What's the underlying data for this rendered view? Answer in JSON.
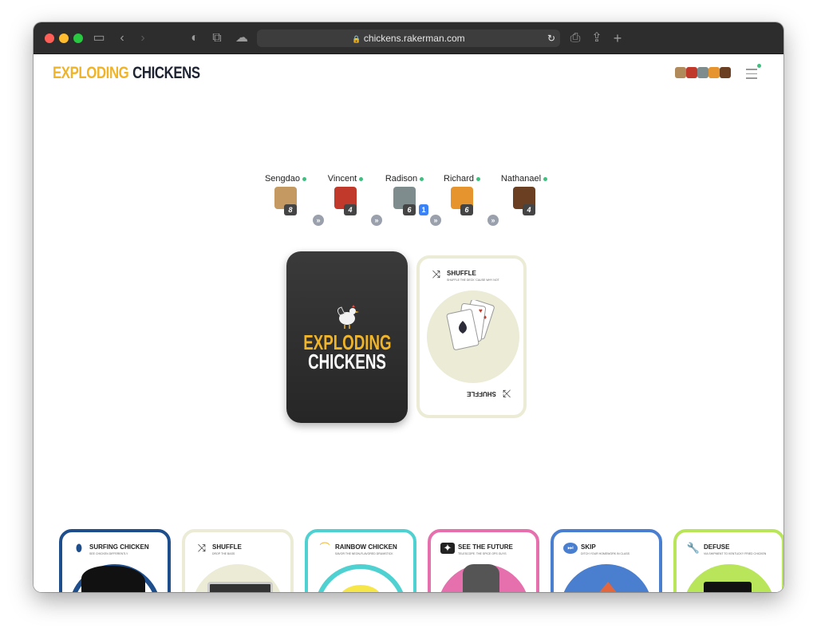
{
  "browser": {
    "url": "chickens.rakerman.com",
    "lock_icon": "lock-icon"
  },
  "header": {
    "logo_part1": "EXPLODING",
    "logo_part2": "CHICKENS",
    "menu_icon": "hamburger-icon"
  },
  "players": [
    {
      "name": "Sengdao",
      "count": "8",
      "animal": "pug"
    },
    {
      "name": "Vincent",
      "count": "4",
      "animal": "bull"
    },
    {
      "name": "Radison",
      "count": "6",
      "badge": "1",
      "animal": "wolf"
    },
    {
      "name": "Richard",
      "count": "6",
      "animal": "lion"
    },
    {
      "name": "Nathanael",
      "count": "4",
      "animal": "bear"
    }
  ],
  "deck": {
    "line1": "EXPLODING",
    "line2": "CHICKENS"
  },
  "discard": {
    "title": "SHUFFLE",
    "subtitle": "SHUFFLE THE DECK 'CAUSE WHY NOT",
    "bottom_label": "SHUFFLE"
  },
  "hand": [
    {
      "title": "SURFING CHICKEN",
      "subtitle": "SEE CHICKEN DIFFERENTLY",
      "color": "#1f4e8c",
      "icon": "surfboard-icon"
    },
    {
      "title": "SHUFFLE",
      "subtitle": "DROP THE BASS",
      "color": "#ecebd6",
      "icon": "shuffle-icon"
    },
    {
      "title": "RAINBOW CHICKEN",
      "subtitle": "SAVOR THE NEON-FLAVORED DRUMSTICK",
      "color": "#4fd1d1",
      "icon": "rainbow-icon"
    },
    {
      "title": "SEE THE FUTURE",
      "subtitle": "TELESCOPE. THE SPICE OPS GUYS",
      "color": "#e66fae",
      "icon": "telescope-icon"
    },
    {
      "title": "SKIP",
      "subtitle": "DITCH YOUR HOMEWORK IN CLASS",
      "color": "#4a7fd0",
      "icon": "skip-icon"
    },
    {
      "title": "DEFUSE",
      "subtitle": "VIA SHIPMENT TO KENTUCKY FRIED CHICKEN",
      "color": "#b9e55a",
      "icon": "wrench-icon"
    }
  ]
}
